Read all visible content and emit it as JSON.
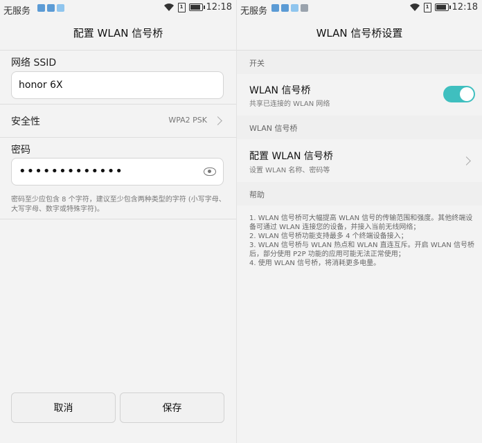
{
  "left_screen": {
    "status": {
      "carrier": "无服务",
      "time": "12:18"
    },
    "title": "配置 WLAN 信号桥",
    "ssid_label": "网络 SSID",
    "ssid_value": "honor 6X",
    "security_label": "安全性",
    "security_value": "WPA2 PSK",
    "password_label": "密码",
    "password_value": "•••••••••••••",
    "hint": "密码至少应包含 8 个字符，建议至少包含两种类型的字符 (小写字母、大写字母、数字或特殊字符)。",
    "cancel": "取消",
    "save": "保存"
  },
  "right_screen": {
    "status": {
      "carrier": "无服务",
      "time": "12:18"
    },
    "title": "WLAN 信号桥设置",
    "section_switch": "开关",
    "bridge_title": "WLAN 信号桥",
    "bridge_subtitle": "共享已连接的 WLAN 网络",
    "bridge_enabled": true,
    "section_bridge": "WLAN 信号桥",
    "config_title": "配置 WLAN 信号桥",
    "config_subtitle": "设置 WLAN 名称、密码等",
    "section_help": "帮助",
    "help_lines": [
      "1. WLAN 信号桥可大幅提高 WLAN 信号的传输范围和强度。其他终端设备可通过 WLAN 连接您的设备，并接入当前无线网络；",
      "2. WLAN 信号桥功能支持最多 4 个终端设备接入；",
      "3. WLAN 信号桥与 WLAN 热点和 WLAN 直连互斥。开启 WLAN 信号桥后，部分使用 P2P 功能的应用可能无法正常使用；",
      "4. 使用 WLAN 信号桥，将消耗更多电量。"
    ]
  },
  "colors": {
    "toggle_on": "#3fbfbf",
    "background": "#f3f3f3"
  },
  "icons": [
    "wifi-icon",
    "sim-card-icon",
    "battery-icon",
    "eye-icon",
    "chevron-right-icon",
    "notification-icon"
  ]
}
